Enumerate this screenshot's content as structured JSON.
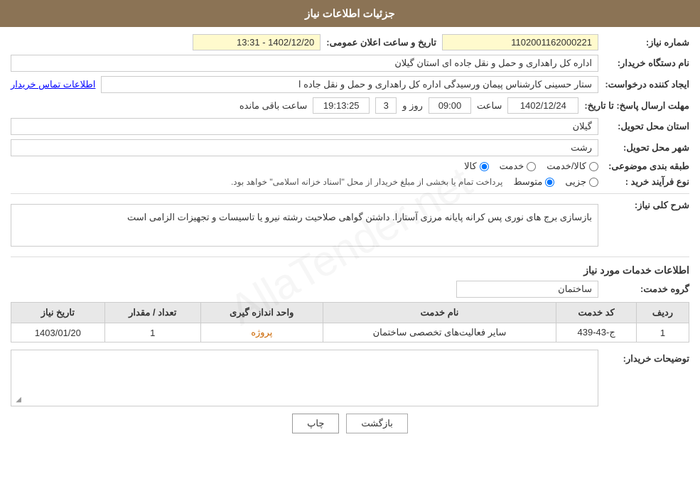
{
  "header": {
    "title": "جزئیات اطلاعات نیاز"
  },
  "fields": {
    "need_number_label": "شماره نیاز:",
    "need_number_value": "1102001162000221",
    "announce_label": "تاریخ و ساعت اعلان عمومی:",
    "announce_value": "1402/12/20 - 13:31",
    "buyer_org_label": "نام دستگاه خریدار:",
    "buyer_org_value": "اداره کل راهداری و حمل و نقل جاده ای استان گیلان",
    "creator_label": "ایجاد کننده درخواست:",
    "creator_value": "ستار حسینی کارشناس پیمان ورسیدگی اداره کل راهداری و حمل و نقل جاده ا",
    "creator_link": "اطلاعات تماس خریدار",
    "deadline_label": "مهلت ارسال پاسخ: تا تاریخ:",
    "deadline_date": "1402/12/24",
    "deadline_time_label": "ساعت",
    "deadline_time": "09:00",
    "deadline_day_label": "روز و",
    "deadline_days": "3",
    "deadline_remaining_label": "ساعت باقی مانده",
    "deadline_remaining": "19:13:25",
    "province_label": "استان محل تحویل:",
    "province_value": "گیلان",
    "city_label": "شهر محل تحویل:",
    "city_value": "رشت",
    "category_label": "طبقه بندی موضوعی:",
    "category_kala": "کالا",
    "category_khedmat": "خدمت",
    "category_kala_khedmat": "کالا/خدمت",
    "purchase_type_label": "نوع فرآیند خرید :",
    "purchase_jozvi": "جزیی",
    "purchase_motaset": "متوسط",
    "purchase_note": "پرداخت تمام یا بخشی از مبلغ خریدار از محل \"اسناد خزانه اسلامی\" خواهد بود.",
    "description_label": "شرح کلی نیاز:",
    "description_text": "بازسازی برج های نوری پس کرانه پایانه مرزی آستارا. داشتن گواهی صلاحیت رشته نیرو یا تاسیسات و تجهیزات الزامی است",
    "services_section_title": "اطلاعات خدمات مورد نیاز",
    "service_group_label": "گروه خدمت:",
    "service_group_value": "ساختمان",
    "table_headers": {
      "row_num": "ردیف",
      "service_code": "کد خدمت",
      "service_name": "نام خدمت",
      "unit": "واحد اندازه گیری",
      "quantity": "تعداد / مقدار",
      "need_date": "تاریخ نیاز"
    },
    "table_rows": [
      {
        "row_num": "1",
        "service_code": "ج-43-439",
        "service_name": "سایر فعالیت‌های تخصصی ساختمان",
        "unit": "پروژه",
        "quantity": "1",
        "need_date": "1403/01/20"
      }
    ],
    "buyer_notes_label": "توضیحات خریدار:",
    "buyer_notes_value": ""
  },
  "buttons": {
    "print": "چاپ",
    "back": "بازگشت"
  },
  "watermark": "AllaTender.net"
}
